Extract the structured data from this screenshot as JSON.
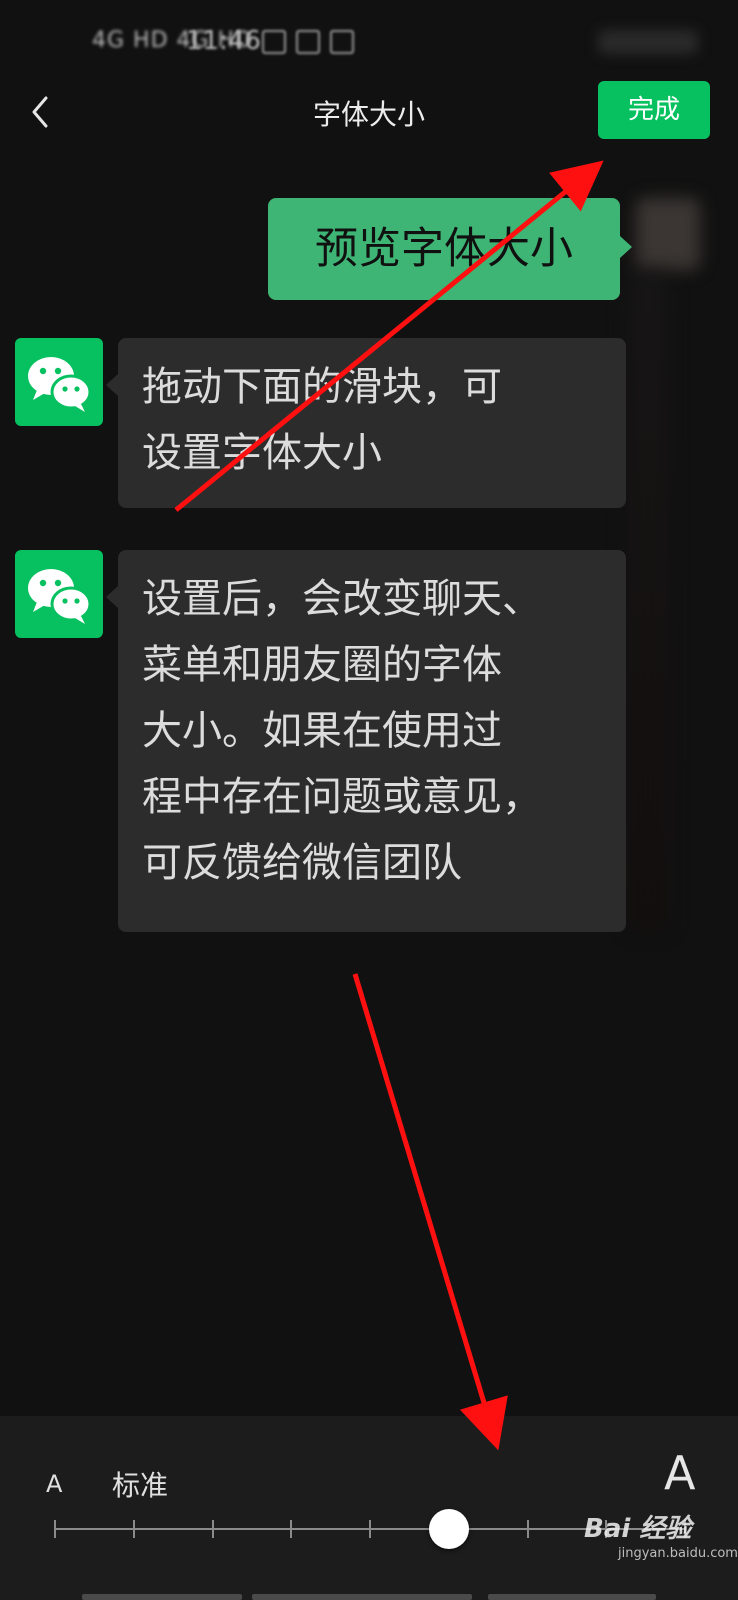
{
  "status_bar": {
    "signal_text": "4G HD  4G HD",
    "time": "11:46"
  },
  "header": {
    "title": "字体大小",
    "done_label": "完成"
  },
  "messages": {
    "preview_bubble": "预览字体大小",
    "bubble_1_lines": [
      "拖动下面的滑块，可",
      "设置字体大小"
    ],
    "bubble_2_lines": [
      "设置后，会改变聊天、",
      "菜单和朋友圈的字体",
      "大小。如果在使用过",
      "程中存在问题或意见，",
      "可反馈给微信团队"
    ]
  },
  "font_slider": {
    "small_label": "A",
    "current_label": "标准",
    "large_label": "A",
    "steps": 8,
    "selected_step": 5,
    "selected_fraction": 0.625
  },
  "watermark": {
    "brand": "Bai 经验",
    "site": "jingyan.baidu.com"
  },
  "colors": {
    "accent_green": "#07c160",
    "bubble_green": "#3eb575",
    "background": "#111111",
    "bubble_dark": "#2c2c2c",
    "annotation_red": "#ff1010"
  },
  "icons": {
    "back": "chevron-left-icon",
    "avatar": "wechat-logo-icon"
  }
}
